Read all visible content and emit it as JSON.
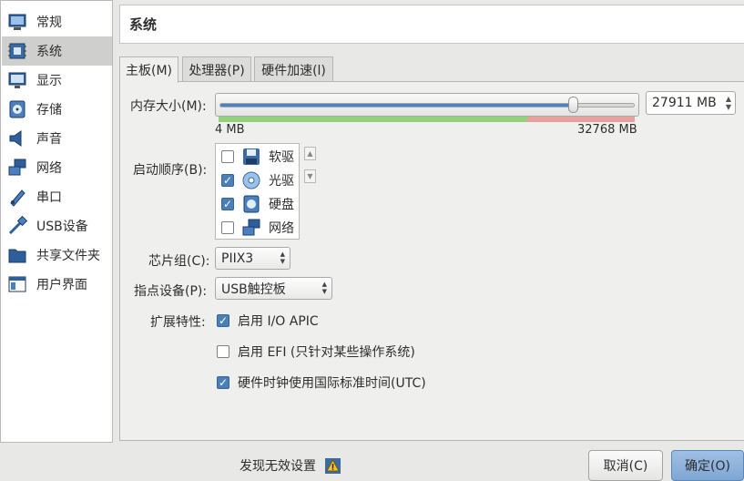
{
  "sidebar": {
    "items": [
      {
        "label": "常规",
        "icon": "general-monitor-icon"
      },
      {
        "label": "系统",
        "icon": "system-chip-icon",
        "selected": true
      },
      {
        "label": "显示",
        "icon": "display-monitor-icon"
      },
      {
        "label": "存储",
        "icon": "storage-disk-icon"
      },
      {
        "label": "声音",
        "icon": "speaker-icon"
      },
      {
        "label": "网络",
        "icon": "network-icon"
      },
      {
        "label": "串口",
        "icon": "serial-port-icon"
      },
      {
        "label": "USB设备",
        "icon": "usb-icon"
      },
      {
        "label": "共享文件夹",
        "icon": "shared-folder-icon"
      },
      {
        "label": "用户界面",
        "icon": "user-interface-icon"
      }
    ]
  },
  "header": {
    "title": "系统"
  },
  "tabs": [
    {
      "label": "主板(M)",
      "active": true
    },
    {
      "label": "处理器(P)",
      "active": false
    },
    {
      "label": "硬件加速(l)",
      "active": false
    }
  ],
  "memory": {
    "label": "内存大小(M):",
    "value": "27911 MB",
    "min_label": "4 MB",
    "max_label": "32768 MB",
    "fraction": 0.852
  },
  "boot_order": {
    "label": "启动顺序(B):",
    "items": [
      {
        "label": "软驱",
        "checked": false,
        "icon": "floppy-icon"
      },
      {
        "label": "光驱",
        "checked": true,
        "icon": "optical-disc-icon"
      },
      {
        "label": "硬盘",
        "checked": true,
        "icon": "hard-disk-icon"
      },
      {
        "label": "网络",
        "checked": false,
        "icon": "network-icon"
      }
    ]
  },
  "chipset": {
    "label": "芯片组(C):",
    "value": "PIIX3"
  },
  "pointing": {
    "label": "指点设备(P):",
    "value": "USB触控板"
  },
  "features": {
    "label": "扩展特性:",
    "ioapic": {
      "label": "启用 I/O APIC",
      "checked": true
    },
    "efi": {
      "label": "启用 EFI (只针对某些操作系统)",
      "checked": false
    },
    "utc": {
      "label": "硬件时钟使用国际标准时间(UTC)",
      "checked": true
    }
  },
  "footer": {
    "warning": "发现无效设置",
    "cancel": "取消(C)",
    "ok": "确定(O)"
  },
  "colors": {
    "accent": "#4a82c8",
    "slider_ok": "#92d17e",
    "slider_warn": "#e9a19e"
  }
}
